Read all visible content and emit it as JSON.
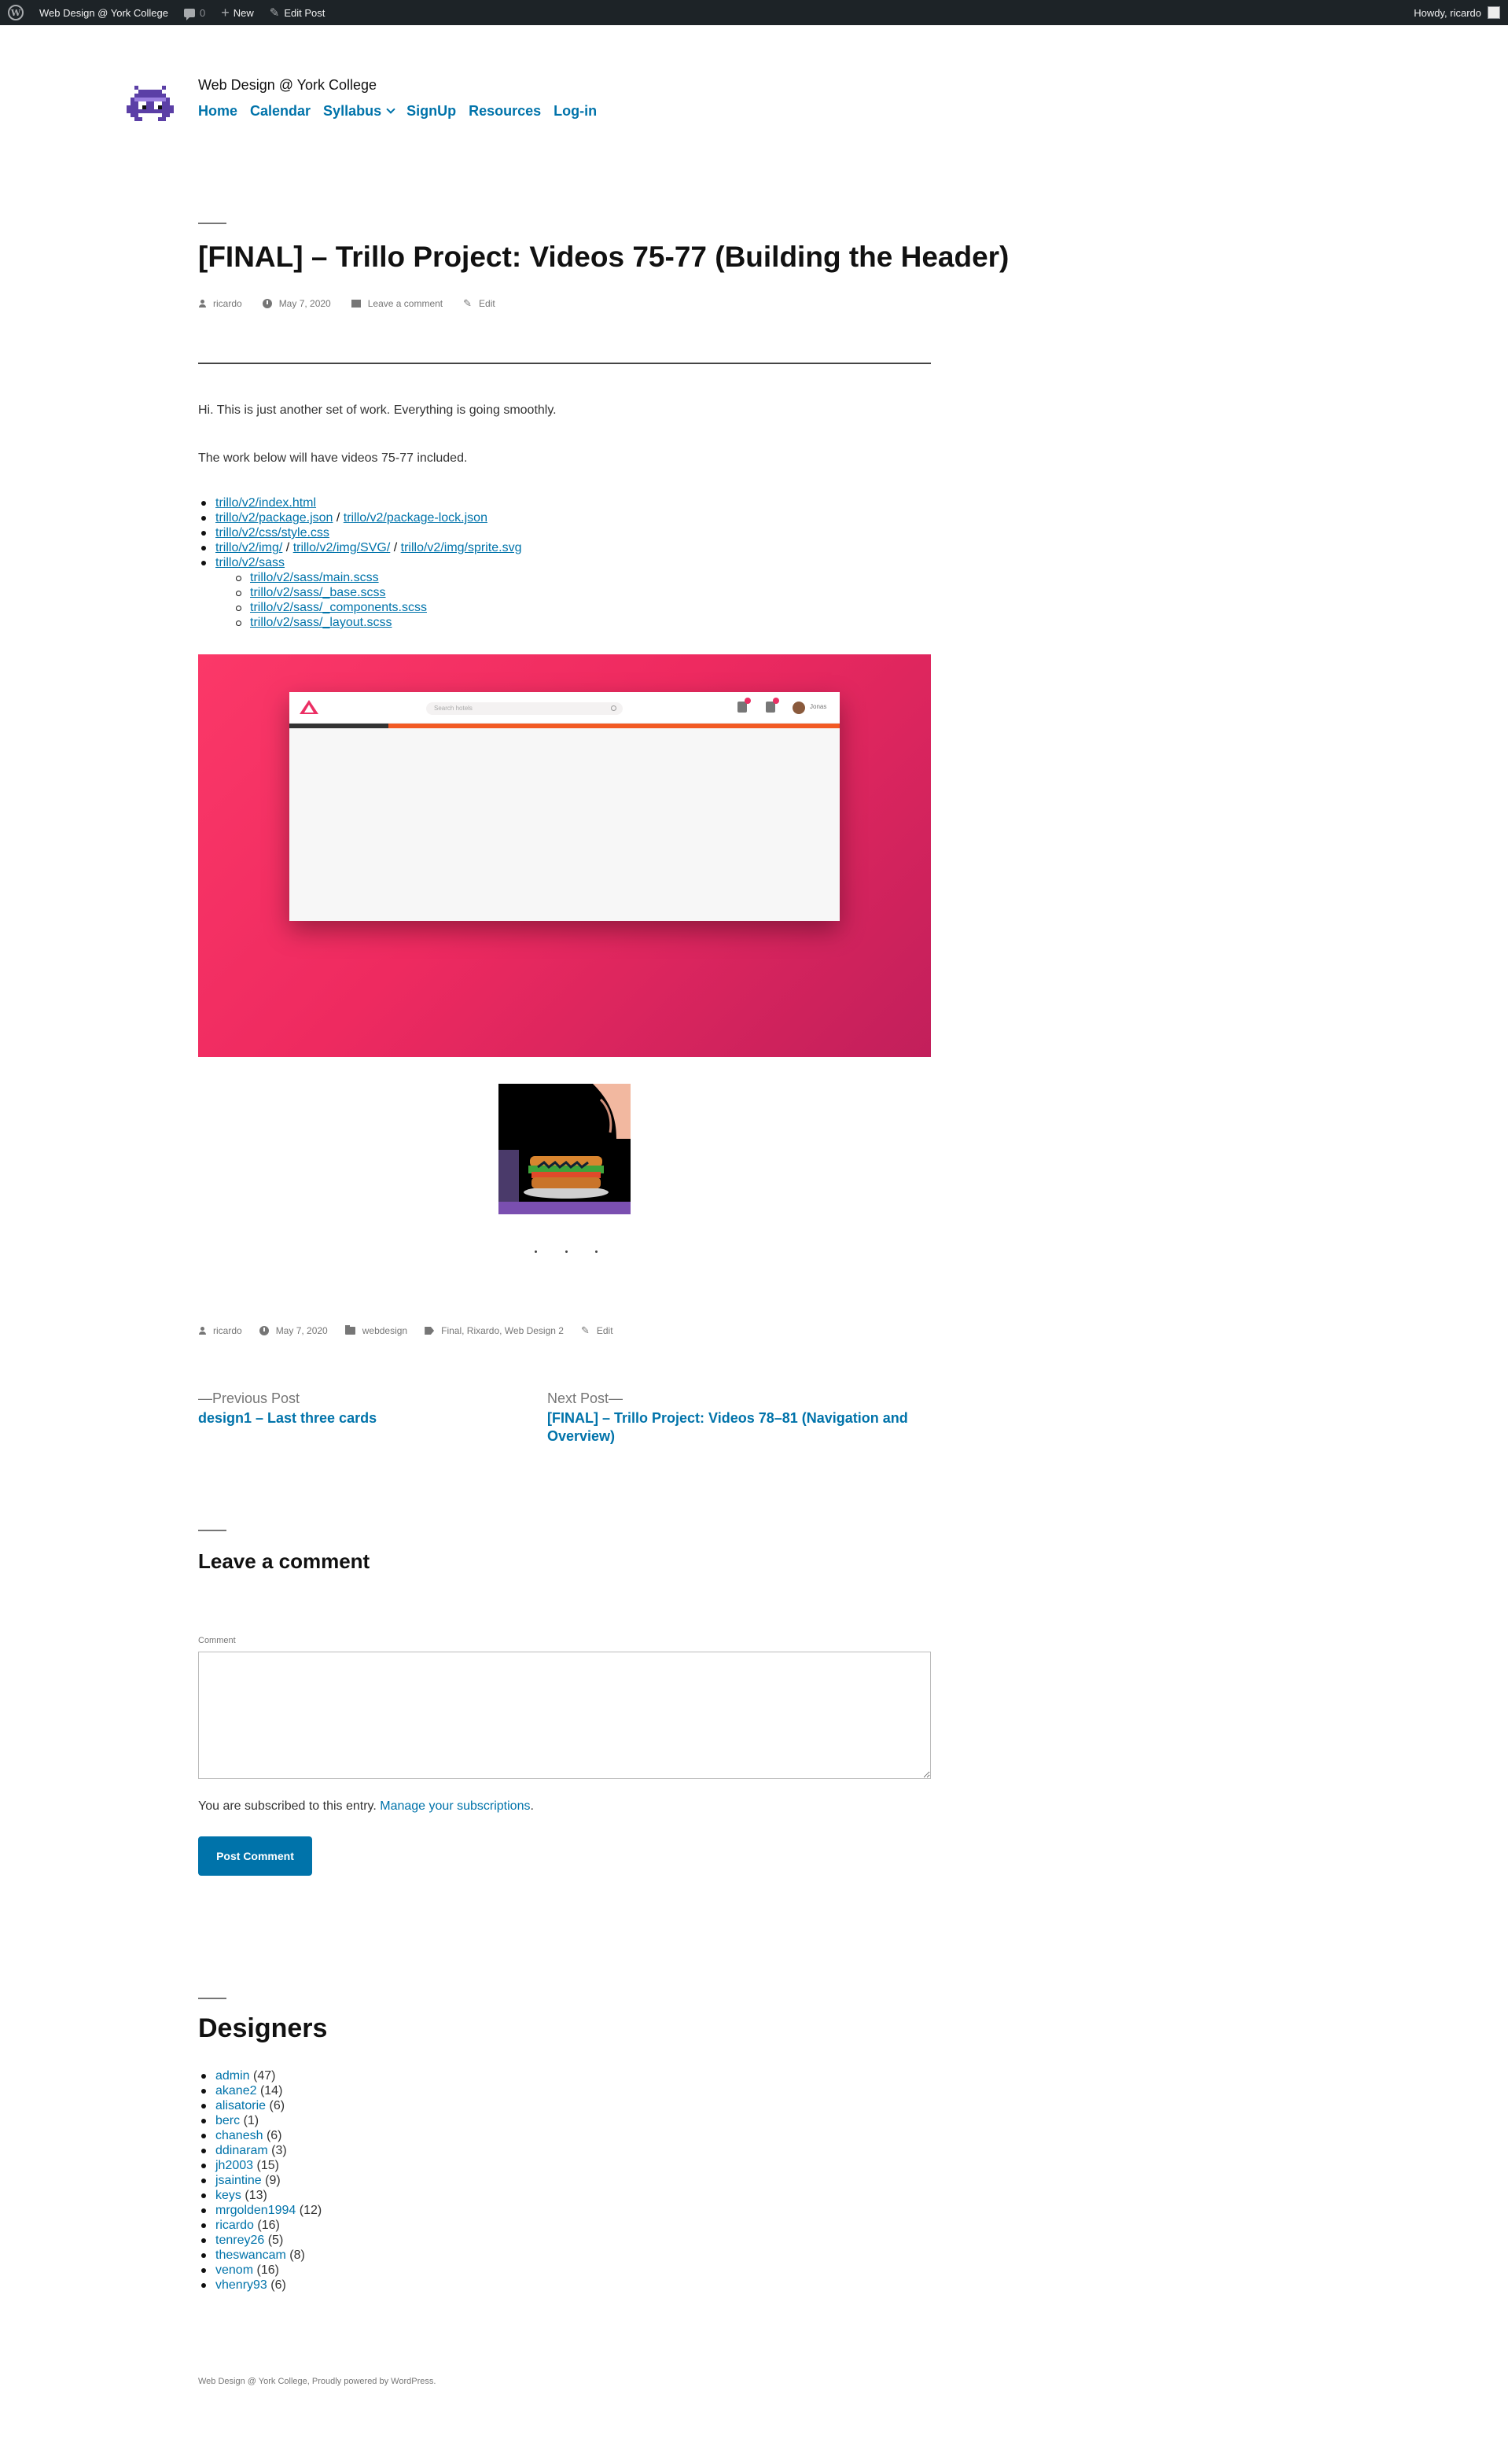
{
  "adminbar": {
    "site_name": "Web Design @ York College",
    "comment_count": "0",
    "new_label": "New",
    "edit_post_label": "Edit Post",
    "howdy": "Howdy, ricardo"
  },
  "site": {
    "title": "Web Design @ York College",
    "nav": [
      "Home",
      "Calendar",
      "Syllabus",
      "SignUp",
      "Resources",
      "Log-in"
    ]
  },
  "post": {
    "title": "[FINAL] – Trillo Project: Videos 75-77 (Building the Header)",
    "meta_top": {
      "author": "ricardo",
      "date": "May 7, 2020",
      "comment_link": "Leave a comment",
      "edit": "Edit"
    },
    "para1": "Hi. This is just another set of work. Everything is going smoothly.",
    "para2": "The work below will have videos 75-77 included.",
    "files": {
      "index": "trillo/v2/index.html",
      "package": "trillo/v2/package.json",
      "package_lock": "trillo/v2/package-lock.json",
      "style": "trillo/v2/css/style.css",
      "img": "trillo/v2/img/",
      "svg": "trillo/v2/img/SVG/",
      "sprite": "trillo/v2/img/sprite.svg",
      "sass": "trillo/v2/sass",
      "sass_main": "trillo/v2/sass/main.scss",
      "sass_base": "trillo/v2/sass/_base.scss",
      "sass_components": "trillo/v2/sass/_components.scss",
      "sass_layout": "trillo/v2/sass/_layout.scss"
    },
    "figure": {
      "search_placeholder": "Search hotels",
      "user_name": "Jonas"
    },
    "meta_bottom": {
      "author": "ricardo",
      "date": "May 7, 2020",
      "category": "webdesign",
      "tags": "Final, Rixardo, Web Design 2",
      "edit": "Edit"
    }
  },
  "post_nav": {
    "prev_label": "—Previous Post",
    "prev_title": "design1 – Last three cards",
    "next_label": "Next Post—",
    "next_title": "[FINAL] – Trillo Project: Videos 78–81 (Navigation and Overview)"
  },
  "comments": {
    "title": "Leave a comment",
    "field_label": "Comment",
    "subscribe_text": "You are subscribed to this entry.",
    "manage_link": "Manage your subscriptions",
    "submit": "Post Comment"
  },
  "designers": {
    "title": "Designers",
    "items": [
      {
        "name": "admin",
        "count": "(47)"
      },
      {
        "name": "akane2",
        "count": "(14)"
      },
      {
        "name": "alisatorie",
        "count": "(6)"
      },
      {
        "name": "berc",
        "count": "(1)"
      },
      {
        "name": "chanesh",
        "count": "(6)"
      },
      {
        "name": "ddinaram",
        "count": "(3)"
      },
      {
        "name": "jh2003",
        "count": "(15)"
      },
      {
        "name": "jsaintine",
        "count": "(9)"
      },
      {
        "name": "keys",
        "count": "(13)"
      },
      {
        "name": "mrgolden1994",
        "count": "(12)"
      },
      {
        "name": "ricardo",
        "count": "(16)"
      },
      {
        "name": "tenrey26",
        "count": "(5)"
      },
      {
        "name": "theswancam",
        "count": "(8)"
      },
      {
        "name": "venom",
        "count": "(16)"
      },
      {
        "name": "vhenry93",
        "count": "(6)"
      }
    ]
  },
  "footer": {
    "text": "Web Design @ York College, Proudly powered by WordPress."
  },
  "colors": {
    "link": "#0073aa",
    "adminbar": "#1d2327",
    "accent_pink": "#eb2f64"
  }
}
